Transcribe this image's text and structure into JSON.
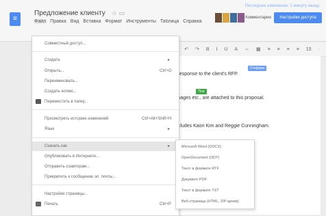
{
  "header": {
    "title": "Предложение клиенту",
    "saved_text": "Последнее изменение: 1 минуту назад",
    "comments_label": "Комментарии",
    "share_label": "Настройки доступа"
  },
  "menubar": [
    "Файл",
    "Правка",
    "Вид",
    "Вставка",
    "Формат",
    "Инструменты",
    "Таблица",
    "Справка"
  ],
  "toolbar": [
    "Ꞥ",
    "↶",
    "↷",
    "B",
    "I",
    "U",
    "A",
    "⇔",
    "▦",
    "≡",
    "≡",
    "≡",
    "≡",
    "15",
    "·"
  ],
  "document": {
    "line1": "l response to the client's RFP.",
    "line2": "images etc., are attached to this proposal.",
    "line3": "ncludes Kaori Kim and Reggie Cunningham.",
    "tag1": "Стефани",
    "tag2": "Tina",
    "tag1_color": "#6d9ef4",
    "tag2_color": "#41a745"
  },
  "file_menu": {
    "share": "Совместный доступ...",
    "new": "Создать",
    "open": "Открыть...",
    "open_shortcut": "Ctrl+O",
    "rename": "Переименовать...",
    "make_copy": "Создать копию...",
    "move_to_folder": "Переместить в папку...",
    "see_revision_history": "Просмотреть историю изменений",
    "see_revision_shortcut": "Ctrl+Alt+Shift+H",
    "language": "Язык",
    "download_as": "Скачать как",
    "publish_to_web": "Опубликовать в Интернете...",
    "email_collaborators": "Отправить соавторам...",
    "email_as_attachment": "Прикрепить к сообщению эл. почты...",
    "page_setup": "Настройки страницы...",
    "print": "Печать",
    "print_shortcut": "Ctrl+P"
  },
  "download_submenu": [
    "Microsoft Word (DOCX)",
    "OpenDocument (ODT)",
    "Текст в формате RTF",
    "Документ PDF",
    "Текст в формате TXT",
    "Веб-страница (HTML, ZIP-архив)"
  ]
}
